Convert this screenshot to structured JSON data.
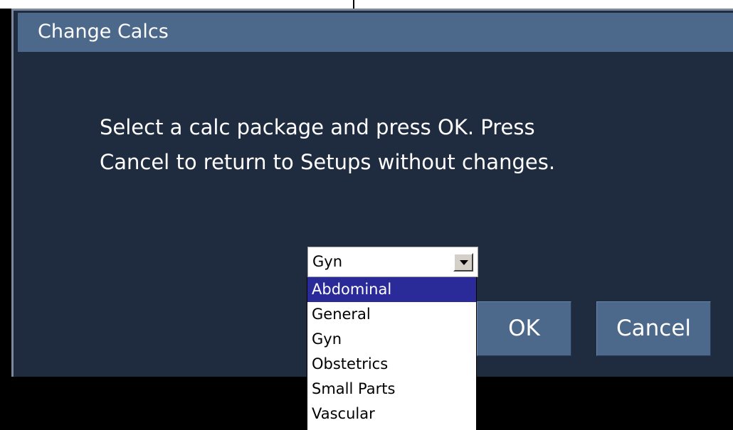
{
  "dialog": {
    "title": "Change Calcs",
    "message_lines": [
      "Select a calc package and press OK. Press",
      "Cancel to return to Setups without changes."
    ]
  },
  "package_select": {
    "value": "Gyn",
    "options": [
      {
        "label": "Abdominal",
        "highlighted": true
      },
      {
        "label": "General",
        "highlighted": false
      },
      {
        "label": "Gyn",
        "highlighted": false
      },
      {
        "label": "Obstetrics",
        "highlighted": false
      },
      {
        "label": "Small Parts",
        "highlighted": false
      },
      {
        "label": "Vascular",
        "highlighted": false
      }
    ]
  },
  "buttons": {
    "ok_label": "OK",
    "cancel_label": "Cancel"
  },
  "colors": {
    "dialog_background": "#1f2b3e",
    "title_bar": "#4c688a",
    "button_background": "#4c688a",
    "highlight": "#2a2a99"
  },
  "icons": {
    "select_arrow": "chevron-down-icon"
  }
}
